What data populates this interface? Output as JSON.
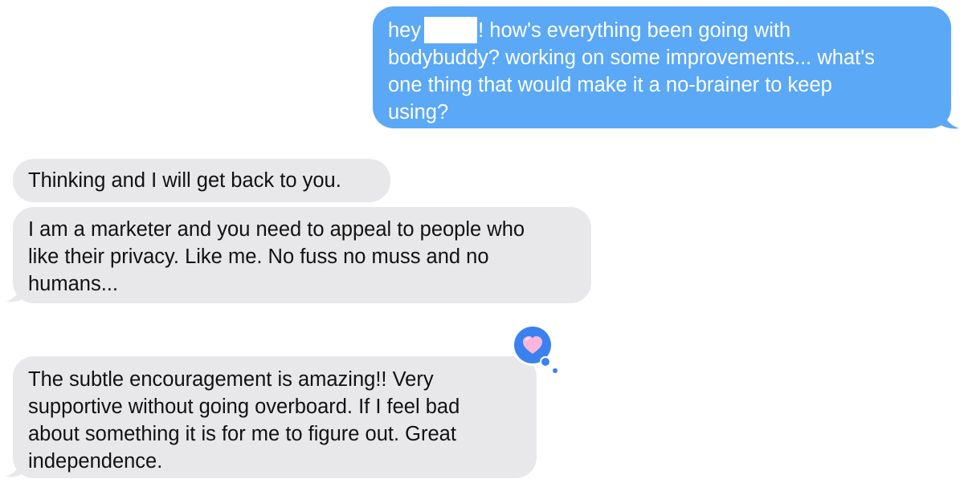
{
  "conversation": {
    "messages": [
      {
        "direction": "sent",
        "lines": [
          {
            "before": "hey",
            "after": "! how's everything been going with"
          },
          "bodybuddy? working on some improvements... what's",
          "one thing that would make it a no-brainer to keep",
          "using?"
        ]
      },
      {
        "direction": "received",
        "lines": [
          "Thinking and I will get back to you."
        ]
      },
      {
        "direction": "received",
        "lines": [
          "I am a marketer and you need to appeal to people who",
          "like their privacy.  Like me.  No fuss no muss and no",
          "humans..."
        ]
      },
      {
        "direction": "received",
        "lines": [
          "The subtle encouragement is amazing!!  Very",
          "supportive without going overboard.  If I feel bad",
          "about something it is for me to figure out.  Great",
          "independence."
        ],
        "reaction": "heart-tapback"
      }
    ]
  },
  "colors": {
    "sent_bubble": "#5aa8f6",
    "received_bubble": "#e8e8ea",
    "redaction": "#ffffff",
    "reaction_badge": "#3b82f0",
    "heart": "#f7b6dc"
  }
}
